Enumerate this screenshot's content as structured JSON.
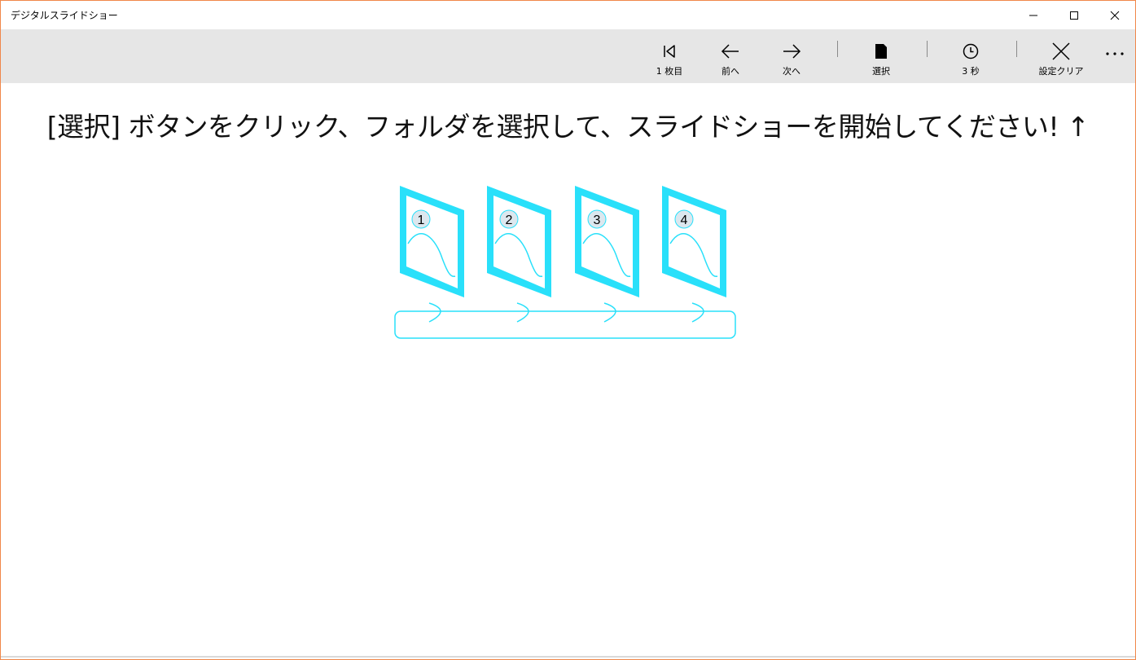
{
  "window": {
    "title": "デジタルスライドショー",
    "accent": "#f0874a"
  },
  "commandbar": {
    "first": {
      "label": "1 枚目",
      "icon": "skip-to-start-icon"
    },
    "prev": {
      "label": "前へ",
      "icon": "arrow-left-icon"
    },
    "next": {
      "label": "次へ",
      "icon": "arrow-right-icon"
    },
    "select": {
      "label": "選択",
      "icon": "folder-icon"
    },
    "interval": {
      "label": "3 秒",
      "icon": "clock-icon"
    },
    "clear": {
      "label": "設定クリア",
      "icon": "close-icon"
    },
    "more_icon": "more-ellipsis-icon"
  },
  "main": {
    "instruction": "[選択] ボタンをクリック、フォルダを選択して、スライドショーを開始してください! ↑",
    "illustration": {
      "accent": "#29e0fa",
      "frames": [
        "1",
        "2",
        "3",
        "4"
      ]
    }
  }
}
